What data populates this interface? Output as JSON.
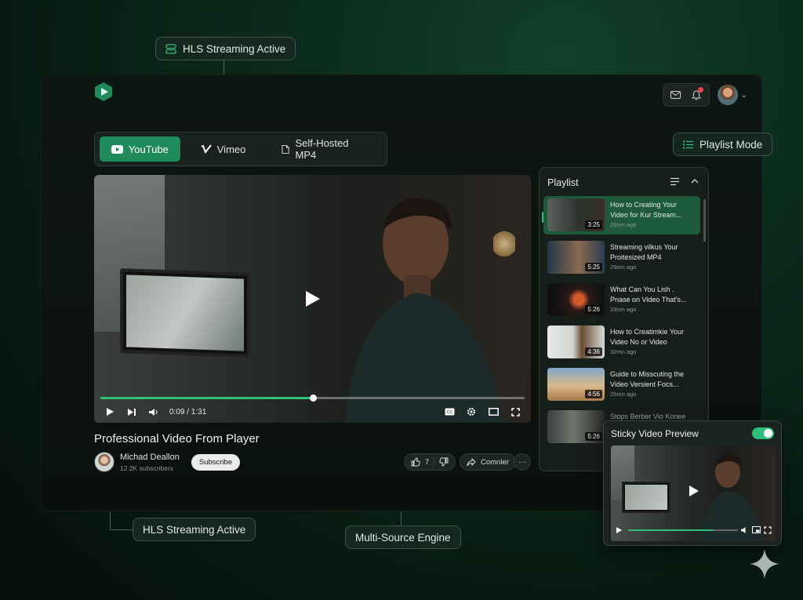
{
  "callouts": {
    "hls_top": "HLS Streaming Active",
    "hls_bottom": "HLS Streaming Active",
    "playlist_mode": "Playlist Mode",
    "multi_source": "Multi-Source Engine"
  },
  "header": {
    "notification_badge": true
  },
  "source_tabs": [
    {
      "label": "YouTube",
      "active": true
    },
    {
      "label": "Vimeo",
      "active": false
    },
    {
      "label": "Self-Hosted MP4",
      "active": false
    }
  ],
  "player": {
    "current_time": "0:09 / 1:31",
    "progress": 0.5,
    "cc_label": "CC"
  },
  "video": {
    "title": "Professional Video From Player",
    "channel_name": "Michad Deallon",
    "subscribers": "12.2K subscribers",
    "subscribe_label": "Subscribe",
    "likes": "7",
    "share_label": "Comnler",
    "more_label": "···"
  },
  "playlist": {
    "title": "Playlist",
    "items": [
      {
        "title_line1": "How to Creating Your",
        "title_line2": "Video for Kur Stream...",
        "time": "29mn ago",
        "duration": "3:25",
        "active": true
      },
      {
        "title_line1": "Streaming vilkus Your",
        "title_line2": "Proitesized MP4",
        "time": "29mn ago",
        "duration": "5:25",
        "active": false
      },
      {
        "title_line1": "What Can You Lish .",
        "title_line2": "Pnase on Video That's...",
        "time": "33mn ago",
        "duration": "5:26",
        "active": false
      },
      {
        "title_line1": "How to Creatimkie Your",
        "title_line2": "Video No or Video",
        "time": "32mn ago",
        "duration": "4:36",
        "active": false
      },
      {
        "title_line1": "Guide to Misscuting the",
        "title_line2": "Video Versient Focs...",
        "time": "25mn ago",
        "duration": "4:56",
        "active": false
      },
      {
        "title_line1": "Stops Berber Vio Konee",
        "title_line2": "",
        "time": "",
        "duration": "5:26",
        "active": false
      }
    ]
  },
  "sticky": {
    "title": "Sticky Video Preview",
    "enabled": true
  },
  "colors": {
    "accent": "#2fbf7a",
    "tab_active": "#1f8a5a",
    "playlist_active": "#1d5a3c",
    "notification": "#e5484d"
  }
}
